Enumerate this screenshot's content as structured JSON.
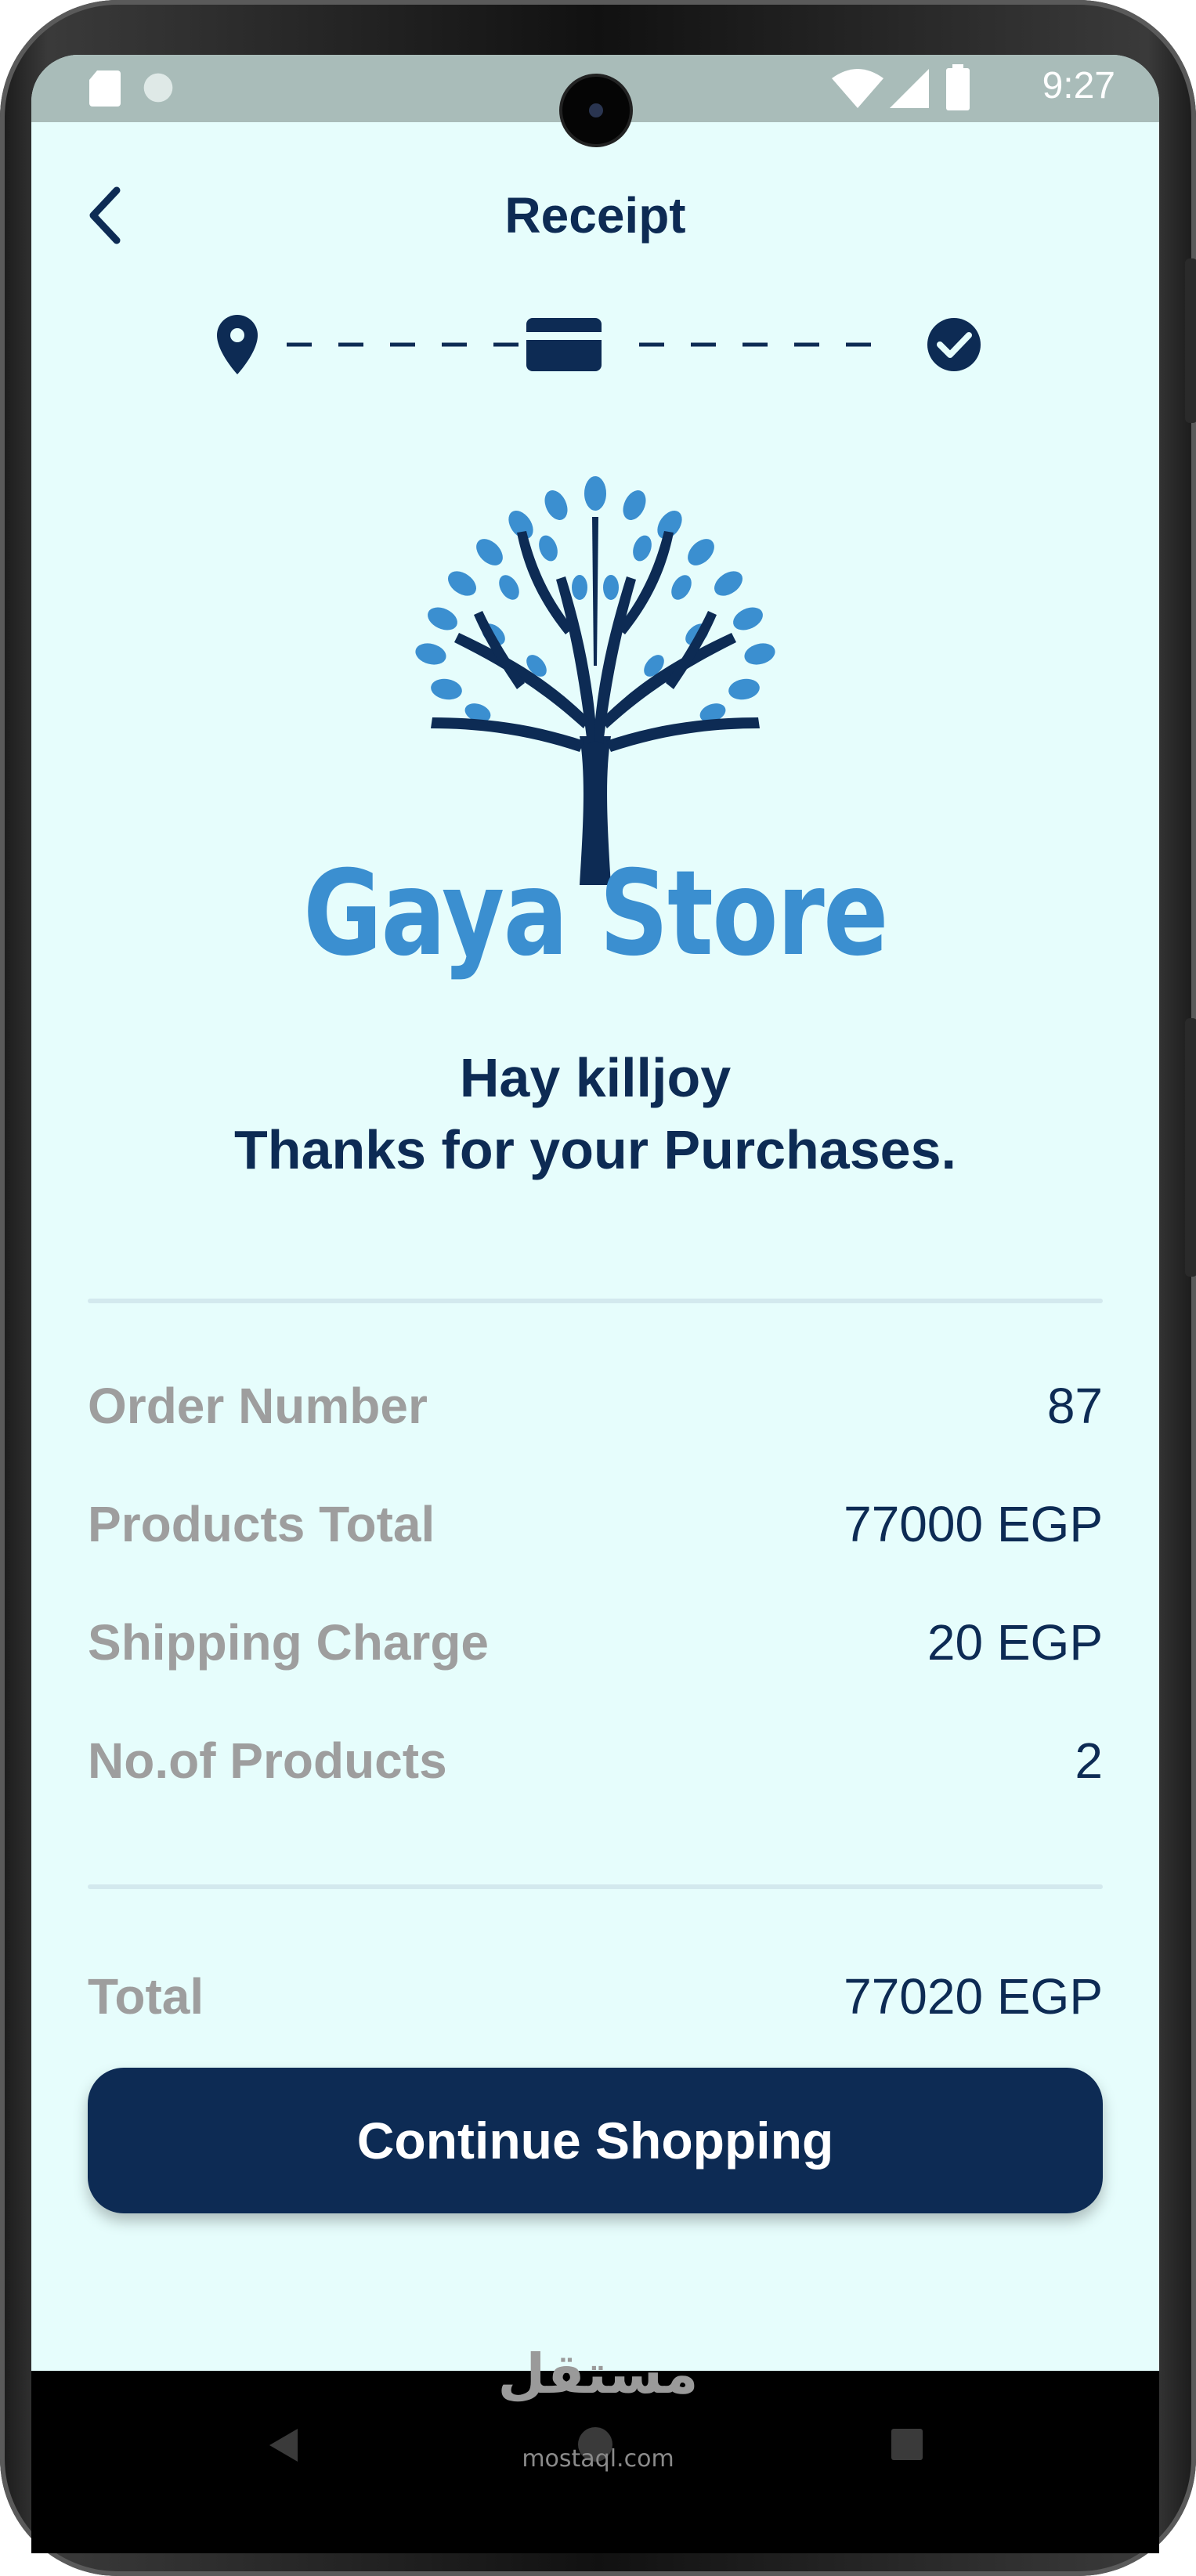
{
  "status_bar": {
    "time": "9:27",
    "icons": [
      "sd-card-icon",
      "circle-notification-icon",
      "wifi-icon",
      "signal-icon",
      "battery-icon"
    ]
  },
  "header": {
    "title": "Receipt",
    "back_icon": "chevron-left-icon"
  },
  "stepper": {
    "steps": [
      "location-pin-icon",
      "credit-card-icon",
      "check-circle-icon"
    ]
  },
  "brand": {
    "name": "Gaya Store",
    "logo_icon": "tree-logo-icon"
  },
  "greeting": {
    "line1": "Hay killjoy",
    "line2": "Thanks for your Purchases."
  },
  "summary": {
    "rows": [
      {
        "label": "Order Number",
        "value": "87"
      },
      {
        "label": "Products Total",
        "value": "77000 EGP"
      },
      {
        "label": "Shipping Charge",
        "value": "20 EGP"
      },
      {
        "label": "No.of Products",
        "value": "2"
      }
    ],
    "total_label": "Total",
    "total_value": "77020 EGP"
  },
  "actions": {
    "continue_label": "Continue Shopping"
  },
  "watermark": {
    "arabic": "مستقل",
    "latin": "mostaql.com"
  },
  "colors": {
    "background": "#e6fdfc",
    "primary": "#0d2b54",
    "brand_blue": "#3b8fd0",
    "label_gray": "#9e9e9e",
    "divider": "#d3e9ee"
  }
}
